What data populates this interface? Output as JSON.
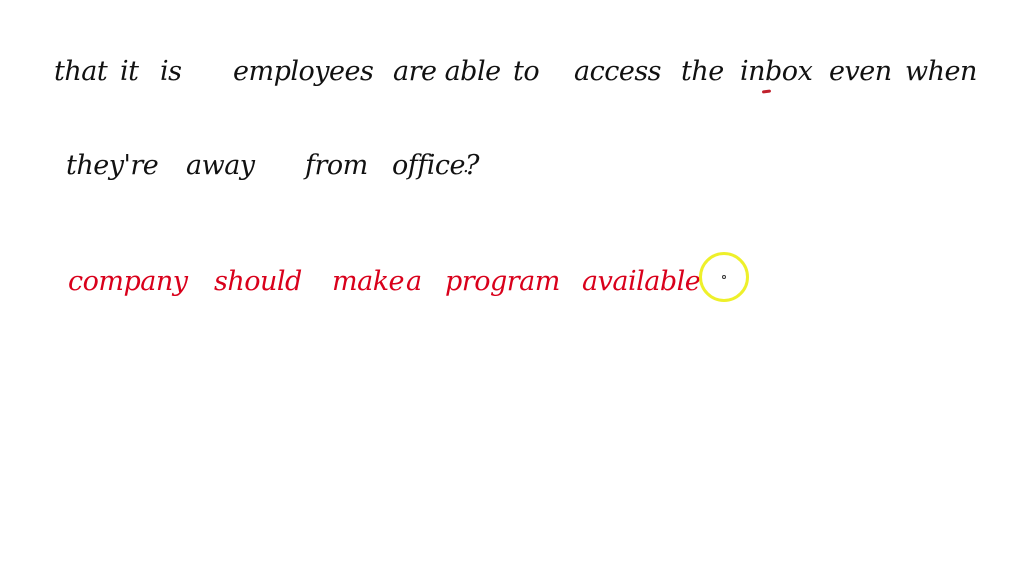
{
  "whiteboard": {
    "lines": [
      {
        "ink": "#111111",
        "words": [
          "that",
          "it",
          "is",
          "employees",
          "are able",
          "to",
          "access",
          "the",
          "inbox",
          "even",
          "when"
        ]
      },
      {
        "ink": "#111111",
        "words": [
          "they're",
          "away",
          "from",
          "office?",
          "."
        ]
      },
      {
        "ink": "#d9001b",
        "words": [
          "company",
          "should",
          "make",
          "a",
          "program",
          "available"
        ]
      }
    ],
    "annotation_mark_color": "#c0202c",
    "cursor": {
      "icon": "pen-cursor-highlight-icon",
      "ring_color": "#eef02a"
    }
  }
}
